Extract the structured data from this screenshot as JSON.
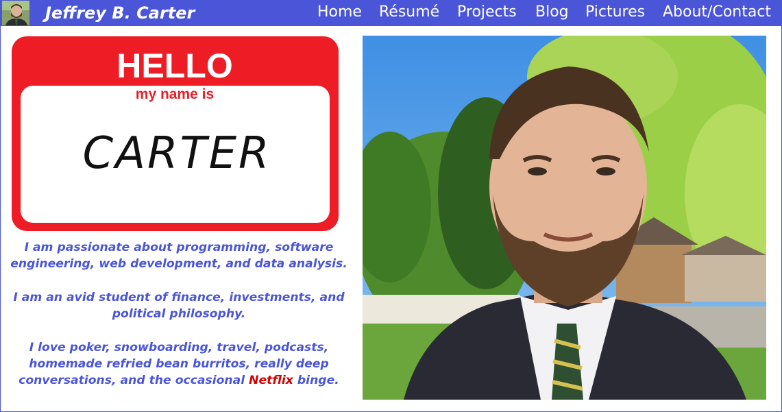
{
  "header": {
    "site_title": "Jeffrey B. Carter",
    "nav": [
      {
        "label": "Home"
      },
      {
        "label": "Résumé"
      },
      {
        "label": "Projects"
      },
      {
        "label": "Blog"
      },
      {
        "label": "Pictures"
      },
      {
        "label": "About/Contact"
      }
    ]
  },
  "nametag": {
    "hello": "HELLO",
    "subtitle": "my name is",
    "name": "CARTER"
  },
  "bio": {
    "paragraph_1": "I am passionate about programming, software engineering, web development, and data analysis.",
    "paragraph_2": "I am an avid student of finance, investments, and political philosophy.",
    "paragraph_3_before": "I love poker, snowboarding, travel, podcasts, homemade refried bean burritos, really deep conversations, and the occasional ",
    "paragraph_3_highlight": "Netflix",
    "paragraph_3_after": " binge."
  },
  "colors": {
    "nav_background": "#4a55d8",
    "text_blue": "#4a55d8",
    "netflix_red": "#d40000",
    "nametag_red": "#ee1c25"
  }
}
